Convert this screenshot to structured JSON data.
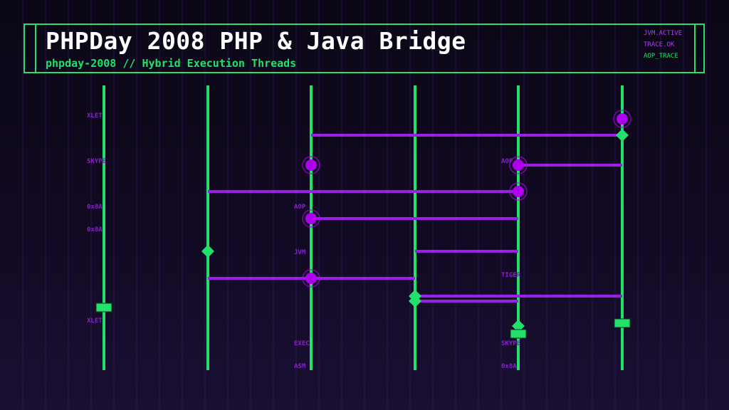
{
  "header": {
    "title": "PHPDay 2008 PHP & Java Bridge",
    "subtitle": "phpday-2008 // Hybrid Execution Threads",
    "status": [
      {
        "label": "JVM.ACTIVE",
        "color": "#b13df0"
      },
      {
        "label": "TRACE.OK",
        "color": "#b13df0"
      },
      {
        "label": "AOP_TRACE",
        "color": "#22e06a"
      }
    ]
  },
  "colors": {
    "thread": "#22e06a",
    "message": "#9d1ee6",
    "node": "#b000f0",
    "label": "#8a1fd0",
    "grid": "#3a1f6e"
  },
  "diagram": {
    "lanes": 6,
    "labels": [
      {
        "lane": 0,
        "row": "r1",
        "text": "XLET"
      },
      {
        "lane": 0,
        "row": "r3",
        "text": "SKYPE"
      },
      {
        "lane": 0,
        "row": "r5",
        "text": "0x8A"
      },
      {
        "lane": 0,
        "row": "r6",
        "text": "0x8A"
      },
      {
        "lane": 0,
        "row": "r10",
        "text": "XLET"
      },
      {
        "lane": 2,
        "row": "r5",
        "text": "AOP"
      },
      {
        "lane": 2,
        "row": "r7",
        "text": "JVM"
      },
      {
        "lane": 2,
        "row": "r11",
        "text": "EXEC"
      },
      {
        "lane": 2,
        "row": "r12",
        "text": "ASM"
      },
      {
        "lane": 4,
        "row": "r3",
        "text": "AOP"
      },
      {
        "lane": 4,
        "row": "r8",
        "text": "TIGER"
      },
      {
        "lane": 4,
        "row": "r11",
        "text": "SKYPE"
      },
      {
        "lane": 4,
        "row": "r12",
        "text": "0x8A"
      }
    ],
    "messages": [
      {
        "from": 2,
        "to": 5,
        "step": 1
      },
      {
        "from": 4,
        "to": 5,
        "step": 2
      },
      {
        "from": 1,
        "to": 4,
        "step": 3
      },
      {
        "from": 2,
        "to": 4,
        "step": 4
      },
      {
        "from": 3,
        "to": 4,
        "step": 5
      },
      {
        "from": 1,
        "to": 3,
        "step": 6
      },
      {
        "from": 3,
        "to": 5,
        "step": 7
      },
      {
        "from": 3,
        "to": 4,
        "step": 8
      }
    ],
    "nodes": [
      {
        "lane": 5,
        "shape": "circle",
        "step": 0
      },
      {
        "lane": 5,
        "shape": "diamond",
        "step": 1
      },
      {
        "lane": 2,
        "shape": "circle",
        "step": 2
      },
      {
        "lane": 4,
        "shape": "circle",
        "step": 2
      },
      {
        "lane": 4,
        "shape": "circle",
        "step": 3
      },
      {
        "lane": 2,
        "shape": "circle",
        "step": 4
      },
      {
        "lane": 1,
        "shape": "diamond",
        "step": 5
      },
      {
        "lane": 2,
        "shape": "circle",
        "step": 6
      },
      {
        "lane": 3,
        "shape": "diamond",
        "step": 7
      },
      {
        "lane": 3,
        "shape": "diamond",
        "step": 8
      },
      {
        "lane": 0,
        "shape": "rect",
        "step": 9
      },
      {
        "lane": 5,
        "shape": "rect",
        "step": 10
      },
      {
        "lane": 4,
        "shape": "diamond",
        "step": 11
      },
      {
        "lane": 4,
        "shape": "rect",
        "step": 12
      }
    ]
  }
}
